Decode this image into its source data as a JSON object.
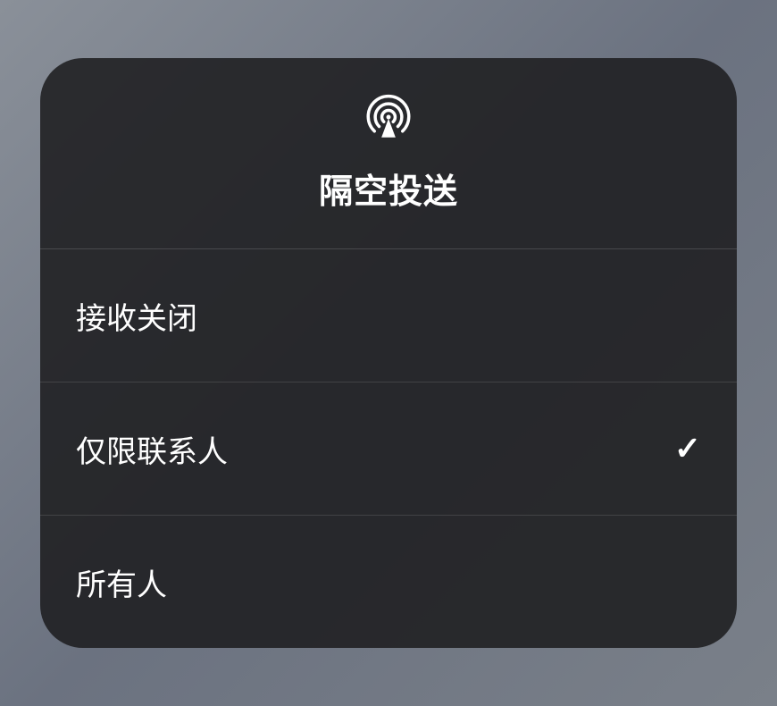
{
  "header": {
    "title": "隔空投送",
    "icon": "airdrop-icon"
  },
  "options": [
    {
      "label": "接收关闭",
      "selected": false
    },
    {
      "label": "仅限联系人",
      "selected": true
    },
    {
      "label": "所有人",
      "selected": false
    }
  ],
  "checkmark_glyph": "✓"
}
